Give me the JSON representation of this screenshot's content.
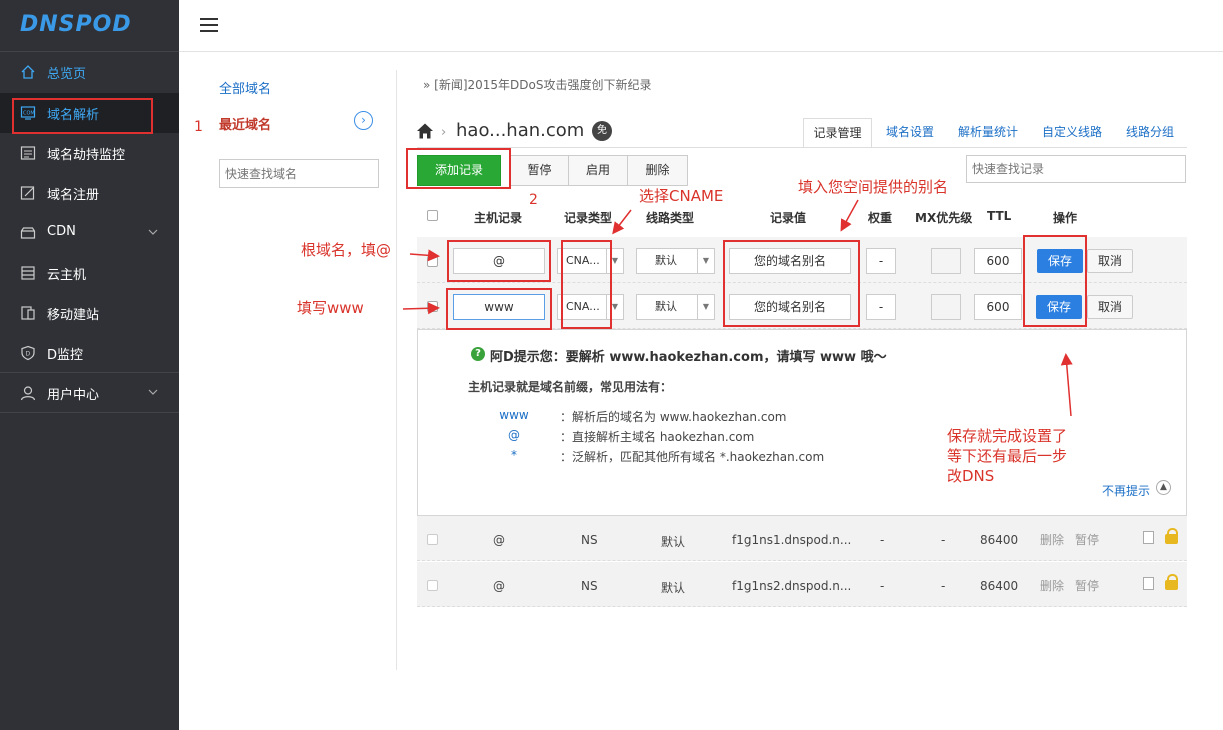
{
  "app": {
    "logo": "DNSPOD"
  },
  "sidebar": {
    "items": [
      {
        "label": "总览页",
        "icon": "home-icon"
      },
      {
        "label": "域名解析",
        "icon": "dns-icon"
      },
      {
        "label": "域名劫持监控",
        "icon": "monitor-icon"
      },
      {
        "label": "域名注册",
        "icon": "register-icon"
      },
      {
        "label": "CDN",
        "icon": "cdn-icon"
      },
      {
        "label": "云主机",
        "icon": "server-icon"
      },
      {
        "label": "移动建站",
        "icon": "mobile-icon"
      },
      {
        "label": "D监控",
        "icon": "shield-icon"
      },
      {
        "label": "用户中心",
        "icon": "user-icon"
      }
    ]
  },
  "domains": {
    "all": "全部域名",
    "recent": "最近域名",
    "search_placeholder": "快速查找域名"
  },
  "news": "» [新闻]2015年DDoS攻击强度创下新纪录",
  "domain": {
    "title": "hao...han.com",
    "badge": "免"
  },
  "tabs": [
    "记录管理",
    "域名设置",
    "解析量统计",
    "自定义线路",
    "线路分组"
  ],
  "toolbar": {
    "add": "添加记录",
    "pause": "暂停",
    "enable": "启用",
    "delete": "删除",
    "search_placeholder": "快速查找记录"
  },
  "columns": [
    "主机记录",
    "记录类型",
    "线路类型",
    "记录值",
    "权重",
    "MX优先级",
    "TTL",
    "操作"
  ],
  "edit_rows": [
    {
      "host": "@",
      "type": "CNA...",
      "line": "默认",
      "value": "您的域名别名",
      "weight": "-",
      "mx": "",
      "ttl": "600",
      "save": "保存",
      "cancel": "取消"
    },
    {
      "host": "www",
      "type": "CNA...",
      "line": "默认",
      "value": "您的域名别名",
      "weight": "-",
      "mx": "",
      "ttl": "600",
      "save": "保存",
      "cancel": "取消"
    }
  ],
  "tip": {
    "icon": "?",
    "title": "阿D提示您：要解析 www.haokezhan.com，请填写 www 哦～",
    "subtitle": "主机记录就是域名前缀，常见用法有：",
    "items": [
      {
        "key": "www",
        "desc": "：解析后的域名为 www.haokezhan.com"
      },
      {
        "key": "@",
        "desc": "：直接解析主域名 haokezhan.com"
      },
      {
        "key": "*",
        "desc": "：泛解析，匹配其他所有域名 *.haokezhan.com"
      }
    ],
    "dismiss": "不再提示"
  },
  "records": [
    {
      "host": "@",
      "type": "NS",
      "line": "默认",
      "value": "f1g1ns1.dnspod.n...",
      "weight": "-",
      "mx": "-",
      "ttl": "86400",
      "delete": "删除",
      "pause": "暂停"
    },
    {
      "host": "@",
      "type": "NS",
      "line": "默认",
      "value": "f1g1ns2.dnspod.n...",
      "weight": "-",
      "mx": "-",
      "ttl": "86400",
      "delete": "删除",
      "pause": "暂停"
    }
  ],
  "annotations": {
    "step1": "1",
    "step2": "2",
    "choose_cname": "选择CNAME",
    "fill_alias": "填入您空间提供的别名",
    "root_domain": "根域名，填@",
    "fill_www": "填写www",
    "save_done_1": "保存就完成设置了",
    "save_done_2": "等下还有最后一步",
    "save_done_3": "改DNS"
  },
  "colors": {
    "sidebar_bg": "#2f3136",
    "accent_blue": "#3fa9f5",
    "add_green": "#2aa836",
    "save_blue": "#2b7fe0",
    "annotation_red": "#e03030"
  }
}
